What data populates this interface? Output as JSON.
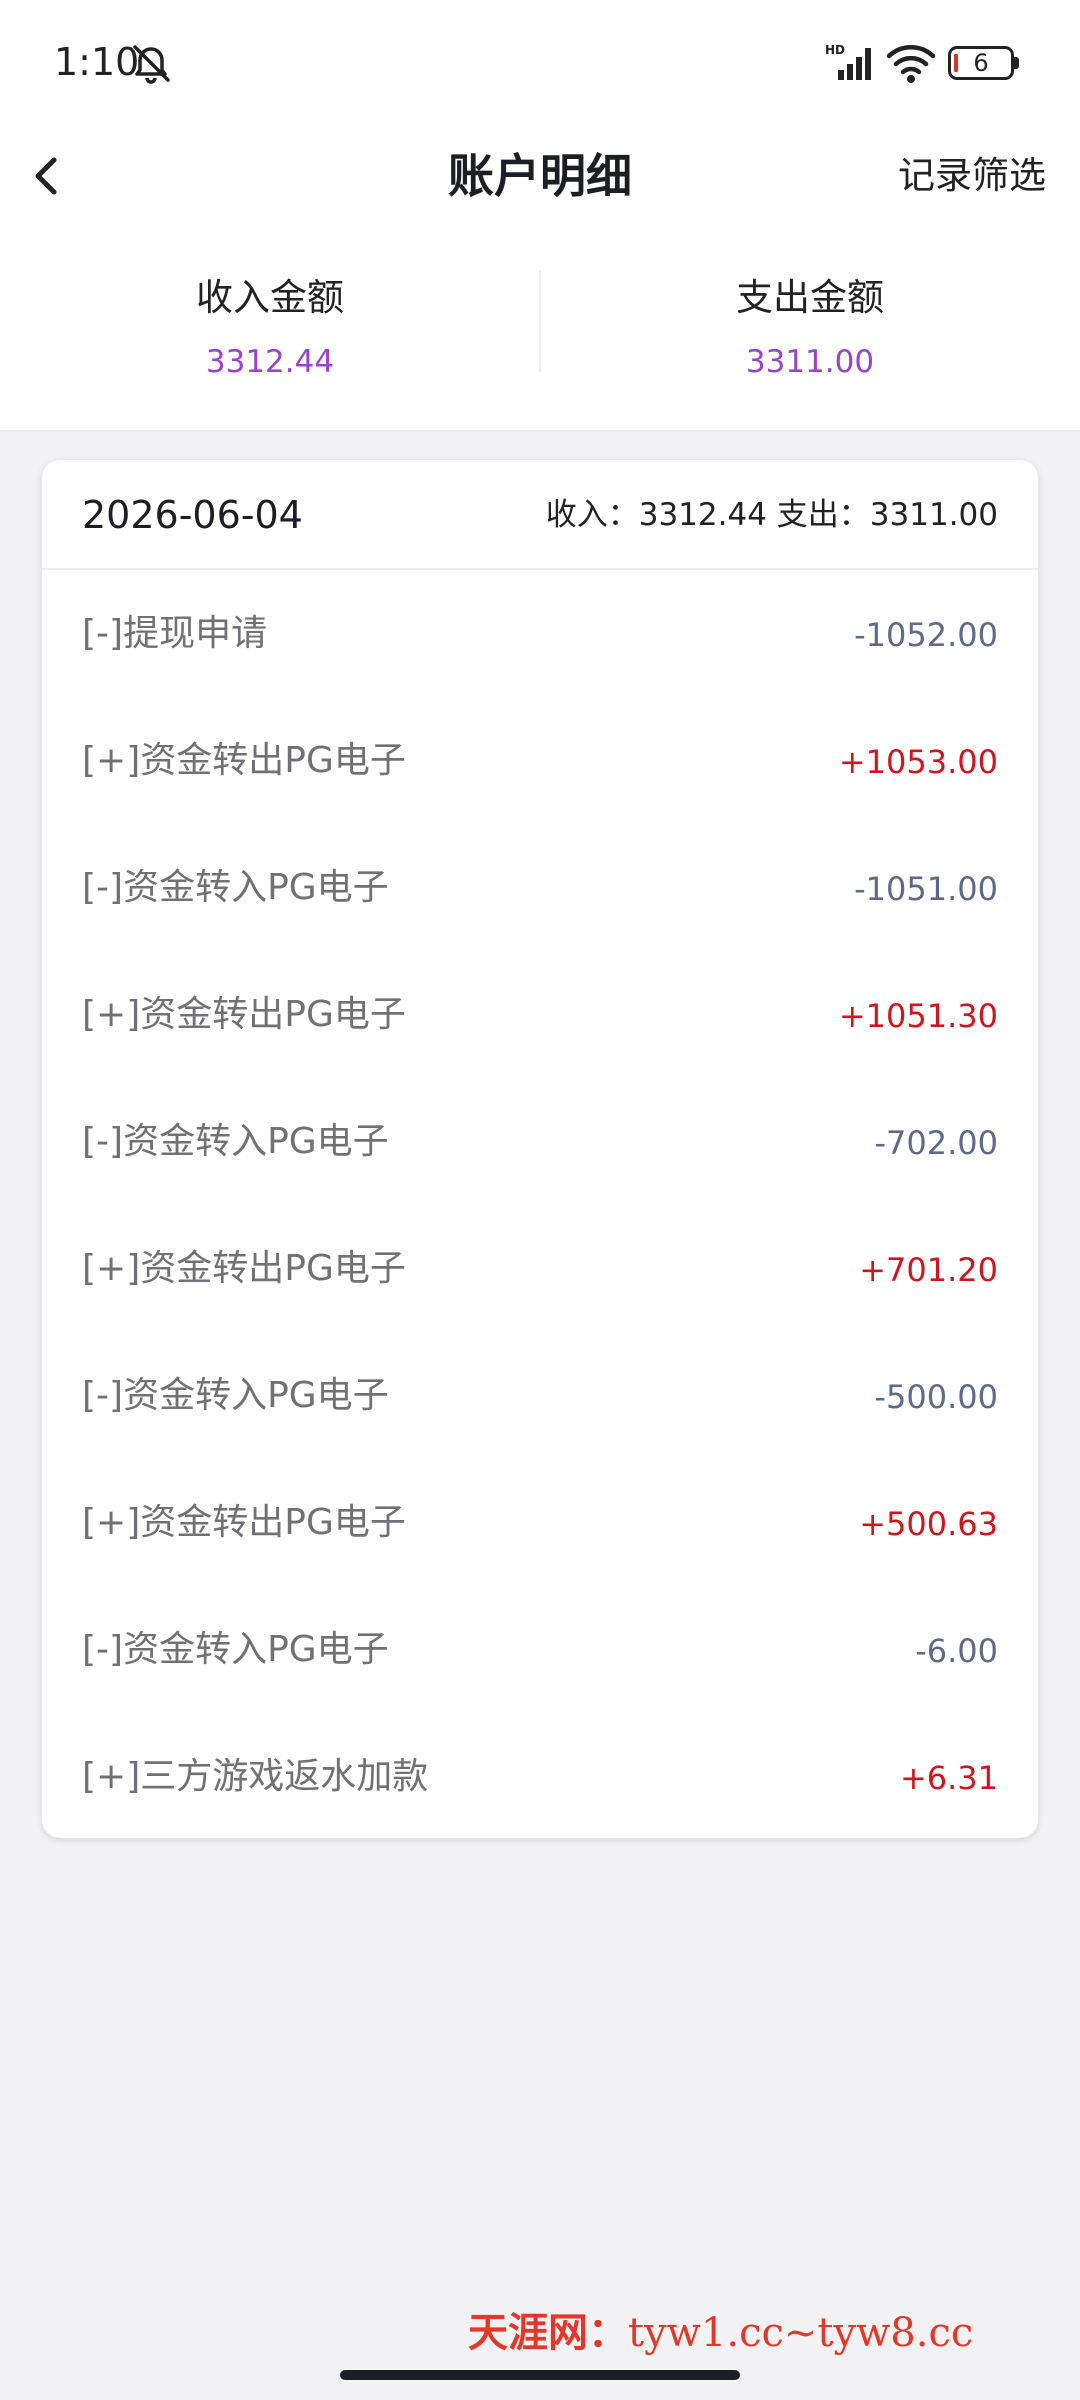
{
  "status_bar": {
    "time": "1:10",
    "hd": "HD",
    "battery": "6"
  },
  "nav": {
    "title": "账户明细",
    "filter_label": "记录筛选"
  },
  "summary": {
    "income_label": "收入金额",
    "income_value": "3312.44",
    "expense_label": "支出金额",
    "expense_value": "3311.00"
  },
  "card": {
    "date": "2026-06-04",
    "totals": "收入：3312.44 支出：3311.00",
    "rows": [
      {
        "label": "[-]提现申请",
        "amount": "-1052.00",
        "type": "neg"
      },
      {
        "label": "[+]资金转出PG电子",
        "amount": "+1053.00",
        "type": "pos"
      },
      {
        "label": "[-]资金转入PG电子",
        "amount": "-1051.00",
        "type": "neg"
      },
      {
        "label": "[+]资金转出PG电子",
        "amount": "+1051.30",
        "type": "pos"
      },
      {
        "label": "[-]资金转入PG电子",
        "amount": "-702.00",
        "type": "neg"
      },
      {
        "label": "[+]资金转出PG电子",
        "amount": "+701.20",
        "type": "pos"
      },
      {
        "label": "[-]资金转入PG电子",
        "amount": "-500.00",
        "type": "neg"
      },
      {
        "label": "[+]资金转出PG电子",
        "amount": "+500.63",
        "type": "pos"
      },
      {
        "label": "[-]资金转入PG电子",
        "amount": "-6.00",
        "type": "neg"
      },
      {
        "label": "[+]三方游戏返水加款",
        "amount": "+6.31",
        "type": "pos"
      }
    ]
  },
  "watermark": {
    "name": "天涯网：",
    "url": "tyw1.cc~tyw8.cc"
  },
  "colors": {
    "accent_purple": "#9a42d0",
    "income_red": "#d4141d",
    "expense_slate": "#5d6a8a",
    "watermark_red": "#e2382a"
  },
  "icons": {
    "mute": "bell-slash-icon",
    "signal": "cellular-signal-icon",
    "wifi": "wifi-icon",
    "battery": "battery-icon",
    "back": "chevron-left-icon"
  }
}
